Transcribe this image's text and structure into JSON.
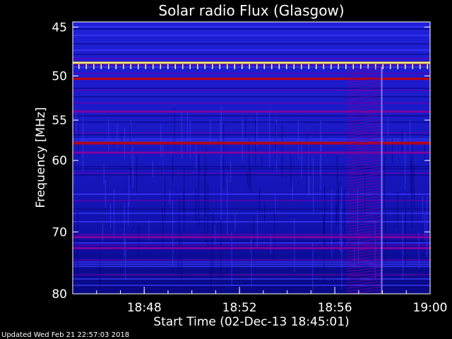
{
  "chart_data": {
    "type": "heatmap",
    "title": "Solar radio Flux (Glasgow)",
    "xlabel": "Start Time (02-Dec-13 18:45:01)",
    "ylabel": "Frequency [MHz]",
    "x_tick_labels": [
      "18:48",
      "18:52",
      "18:56",
      "19:00"
    ],
    "x_ticks_minutes_after_1845": [
      3,
      7,
      11,
      15
    ],
    "x_range_minutes_after_1845": [
      0,
      15
    ],
    "y_ticks": [
      45,
      50,
      55,
      60,
      70,
      80
    ],
    "y_range": [
      44.5,
      80
    ],
    "y_scale": "log",
    "colormap": [
      "#000040",
      "#0000a0",
      "#1010ff",
      "#8000a0",
      "#d00000",
      "#ffc000",
      "#ffffff"
    ],
    "persistent_emission_lines_mhz": [
      {
        "freq": 48.6,
        "level": "very high"
      },
      {
        "freq": 50.3,
        "level": "high"
      },
      {
        "freq": 54.0,
        "level": "medium"
      },
      {
        "freq": 57.8,
        "level": "medium-high"
      },
      {
        "freq": 59.0,
        "level": "medium"
      },
      {
        "freq": 70.8,
        "level": "medium"
      },
      {
        "freq": 72.5,
        "level": "medium"
      }
    ],
    "interference_region": {
      "start": "18:56:30",
      "end": "18:58:00",
      "freq_range": [
        49,
        80
      ]
    }
  },
  "footer": {
    "updated": "Updated Wed Feb 21 22:57:03 2018"
  }
}
